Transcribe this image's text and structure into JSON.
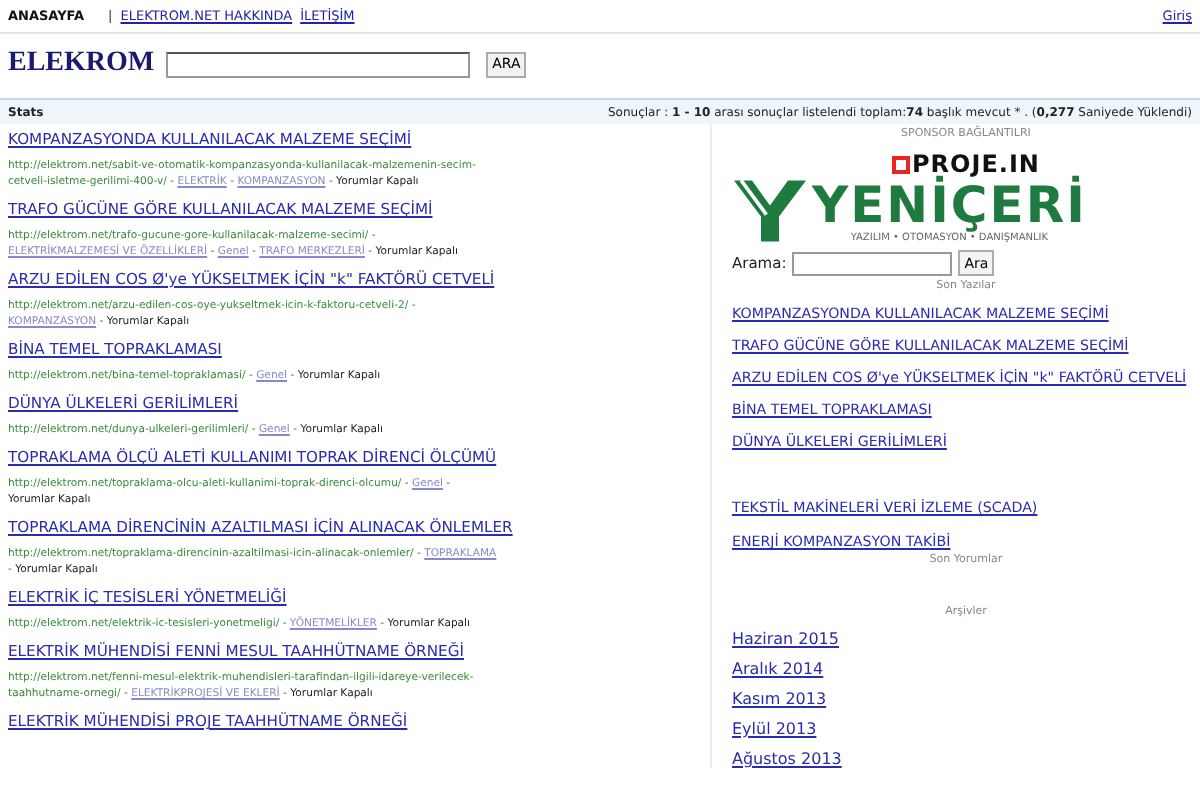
{
  "top_nav": {
    "items": [
      {
        "kind": "current",
        "label": "ANASAYFA"
      },
      {
        "kind": "separator",
        "label": "|"
      },
      {
        "kind": "link",
        "label": "ELEKTROM.NET HAKKINDA"
      },
      {
        "kind": "link",
        "label": "İLETİŞİM"
      }
    ],
    "login": "Giriş"
  },
  "header": {
    "logo": "ELEKROM",
    "search_button": "ARA"
  },
  "stats_bar": {
    "title": "Stats",
    "summary": "Sonuçlar : **1 - 10** arası sonuçlar listelendi toplam:**74** başlık mevcut * . (**0,277** Saniyede Yüklendi)"
  },
  "results": [
    {
      "title": "KOMPANZASYONDA KULLANILACAK MALZEME SEÇİMİ",
      "url": "http://elektrom.net/sabit-ve-otomatik-kompanzasyonda-kullanilacak-malzemenin-secim-cetveli-isletme-gerilimi-400-v/",
      "separator": "-",
      "categories": [
        "ELEKTRİK",
        "KOMPANZASYON"
      ],
      "comments": "Yorumlar Kapalı"
    },
    {
      "title": "TRAFO GÜCÜNE GÖRE KULLANILACAK MALZEME SEÇİMİ",
      "url": "http://elektrom.net/trafo-gucune-gore-kullanilacak-malzeme-secimi/",
      "separator": "-",
      "categories": [
        "ELEKTRİKMALZEMESİ VE ÖZELLİKLERİ",
        "Genel",
        "TRAFO MERKEZLERİ"
      ],
      "comments": "Yorumlar Kapalı"
    },
    {
      "title": "ARZU EDİLEN COS Ø'ye YÜKSELTMEK İÇİN \"k\" FAKTÖRÜ CETVELİ",
      "url": "http://elektrom.net/arzu-edilen-cos-oye-yukseltmek-icin-k-faktoru-cetveli-2/",
      "separator": "-",
      "categories": [
        "KOMPANZASYON"
      ],
      "comments": "Yorumlar Kapalı"
    },
    {
      "title": "BİNA TEMEL TOPRAKLAMASI",
      "url": "http://elektrom.net/bina-temel-topraklamasi/",
      "separator": "-",
      "categories": [
        "Genel"
      ],
      "comments": "Yorumlar Kapalı"
    },
    {
      "title": "DÜNYA ÜLKELERİ GERİLİMLERİ",
      "url": "http://elektrom.net/dunya-ulkeleri-gerilimleri/",
      "separator": "-",
      "categories": [
        "Genel"
      ],
      "comments": "Yorumlar Kapalı"
    },
    {
      "title": "TOPRAKLAMA ÖLÇÜ ALETİ KULLANIMI TOPRAK DİRENCİ ÖLÇÜMÜ",
      "url": "http://elektrom.net/topraklama-olcu-aleti-kullanimi-toprak-direnci-olcumu/",
      "separator": "-",
      "categories": [
        "Genel"
      ],
      "comments": "Yorumlar Kapalı"
    },
    {
      "title": "TOPRAKLAMA DİRENCİNİN AZALTILMASI İÇİN ALINACAK ÖNLEMLER",
      "url": "http://elektrom.net/topraklama-direncinin-azaltilmasi-icin-alinacak-onlemler/",
      "separator": "-",
      "categories": [
        "TOPRAKLAMA"
      ],
      "comments": "Yorumlar Kapalı"
    },
    {
      "title": "ELEKTRİK İÇ TESİSLERİ YÖNETMELİĞİ",
      "url": "http://elektrom.net/elektrik-ic-tesisleri-yonetmeligi/",
      "separator": "-",
      "categories": [
        "YÖNETMELİKLER"
      ],
      "comments": "Yorumlar Kapalı"
    },
    {
      "title": "ELEKTRİK MÜHENDİSİ FENNİ MESUL TAAHHÜTNAME ÖRNEĞİ",
      "url": "http://elektrom.net/fenni-mesul-elektrik-muhendisleri-tarafindan-ilgili-idareye-verilecek-taahhutname-ornegi/",
      "separator": "-",
      "categories": [
        "ELEKTRİKPROJESİ VE EKLERİ"
      ],
      "comments": "Yorumlar Kapalı"
    },
    {
      "title": "ELEKTRİK MÜHENDİSİ PROJE TAAHHÜTNAME ÖRNEĞİ"
    }
  ],
  "sidebar": {
    "sponsor_heading": "SPONSOR BAĞLANTILRI",
    "proje_logo": "PROJE.IN",
    "yeniceri_logo": "YENİÇERİ",
    "yeniceri_tagline": "YAZILIM • OTOMASYON • DANIŞMANLIK",
    "search_label": "Arama:",
    "search_button": "Ara",
    "recent_heading": "Son Yazılar",
    "recent_posts": [
      "KOMPANZASYONDA KULLANILACAK MALZEME SEÇİMİ",
      "TRAFO GÜCÜNE GÖRE KULLANILACAK MALZEME SEÇİMİ",
      "ARZU EDİLEN COS Ø'ye YÜKSELTMEK İÇİN \"k\" FAKTÖRÜ CETVELİ",
      "BİNA TEMEL TOPRAKLAMASI",
      "DÜNYA ÜLKELERİ GERİLİMLERİ"
    ],
    "pages": [
      "TEKSTİL MAKİNELERİ VERİ İZLEME (SCADA)",
      "ENERJİ KOMPANZASYON TAKİBİ"
    ],
    "comments_heading": "Son Yorumlar",
    "archives_heading": "Arşivler",
    "archives": [
      "Haziran 2015",
      "Aralık 2014",
      "Kasım 2013",
      "Eylül 2013",
      "Ağustos 2013"
    ]
  }
}
